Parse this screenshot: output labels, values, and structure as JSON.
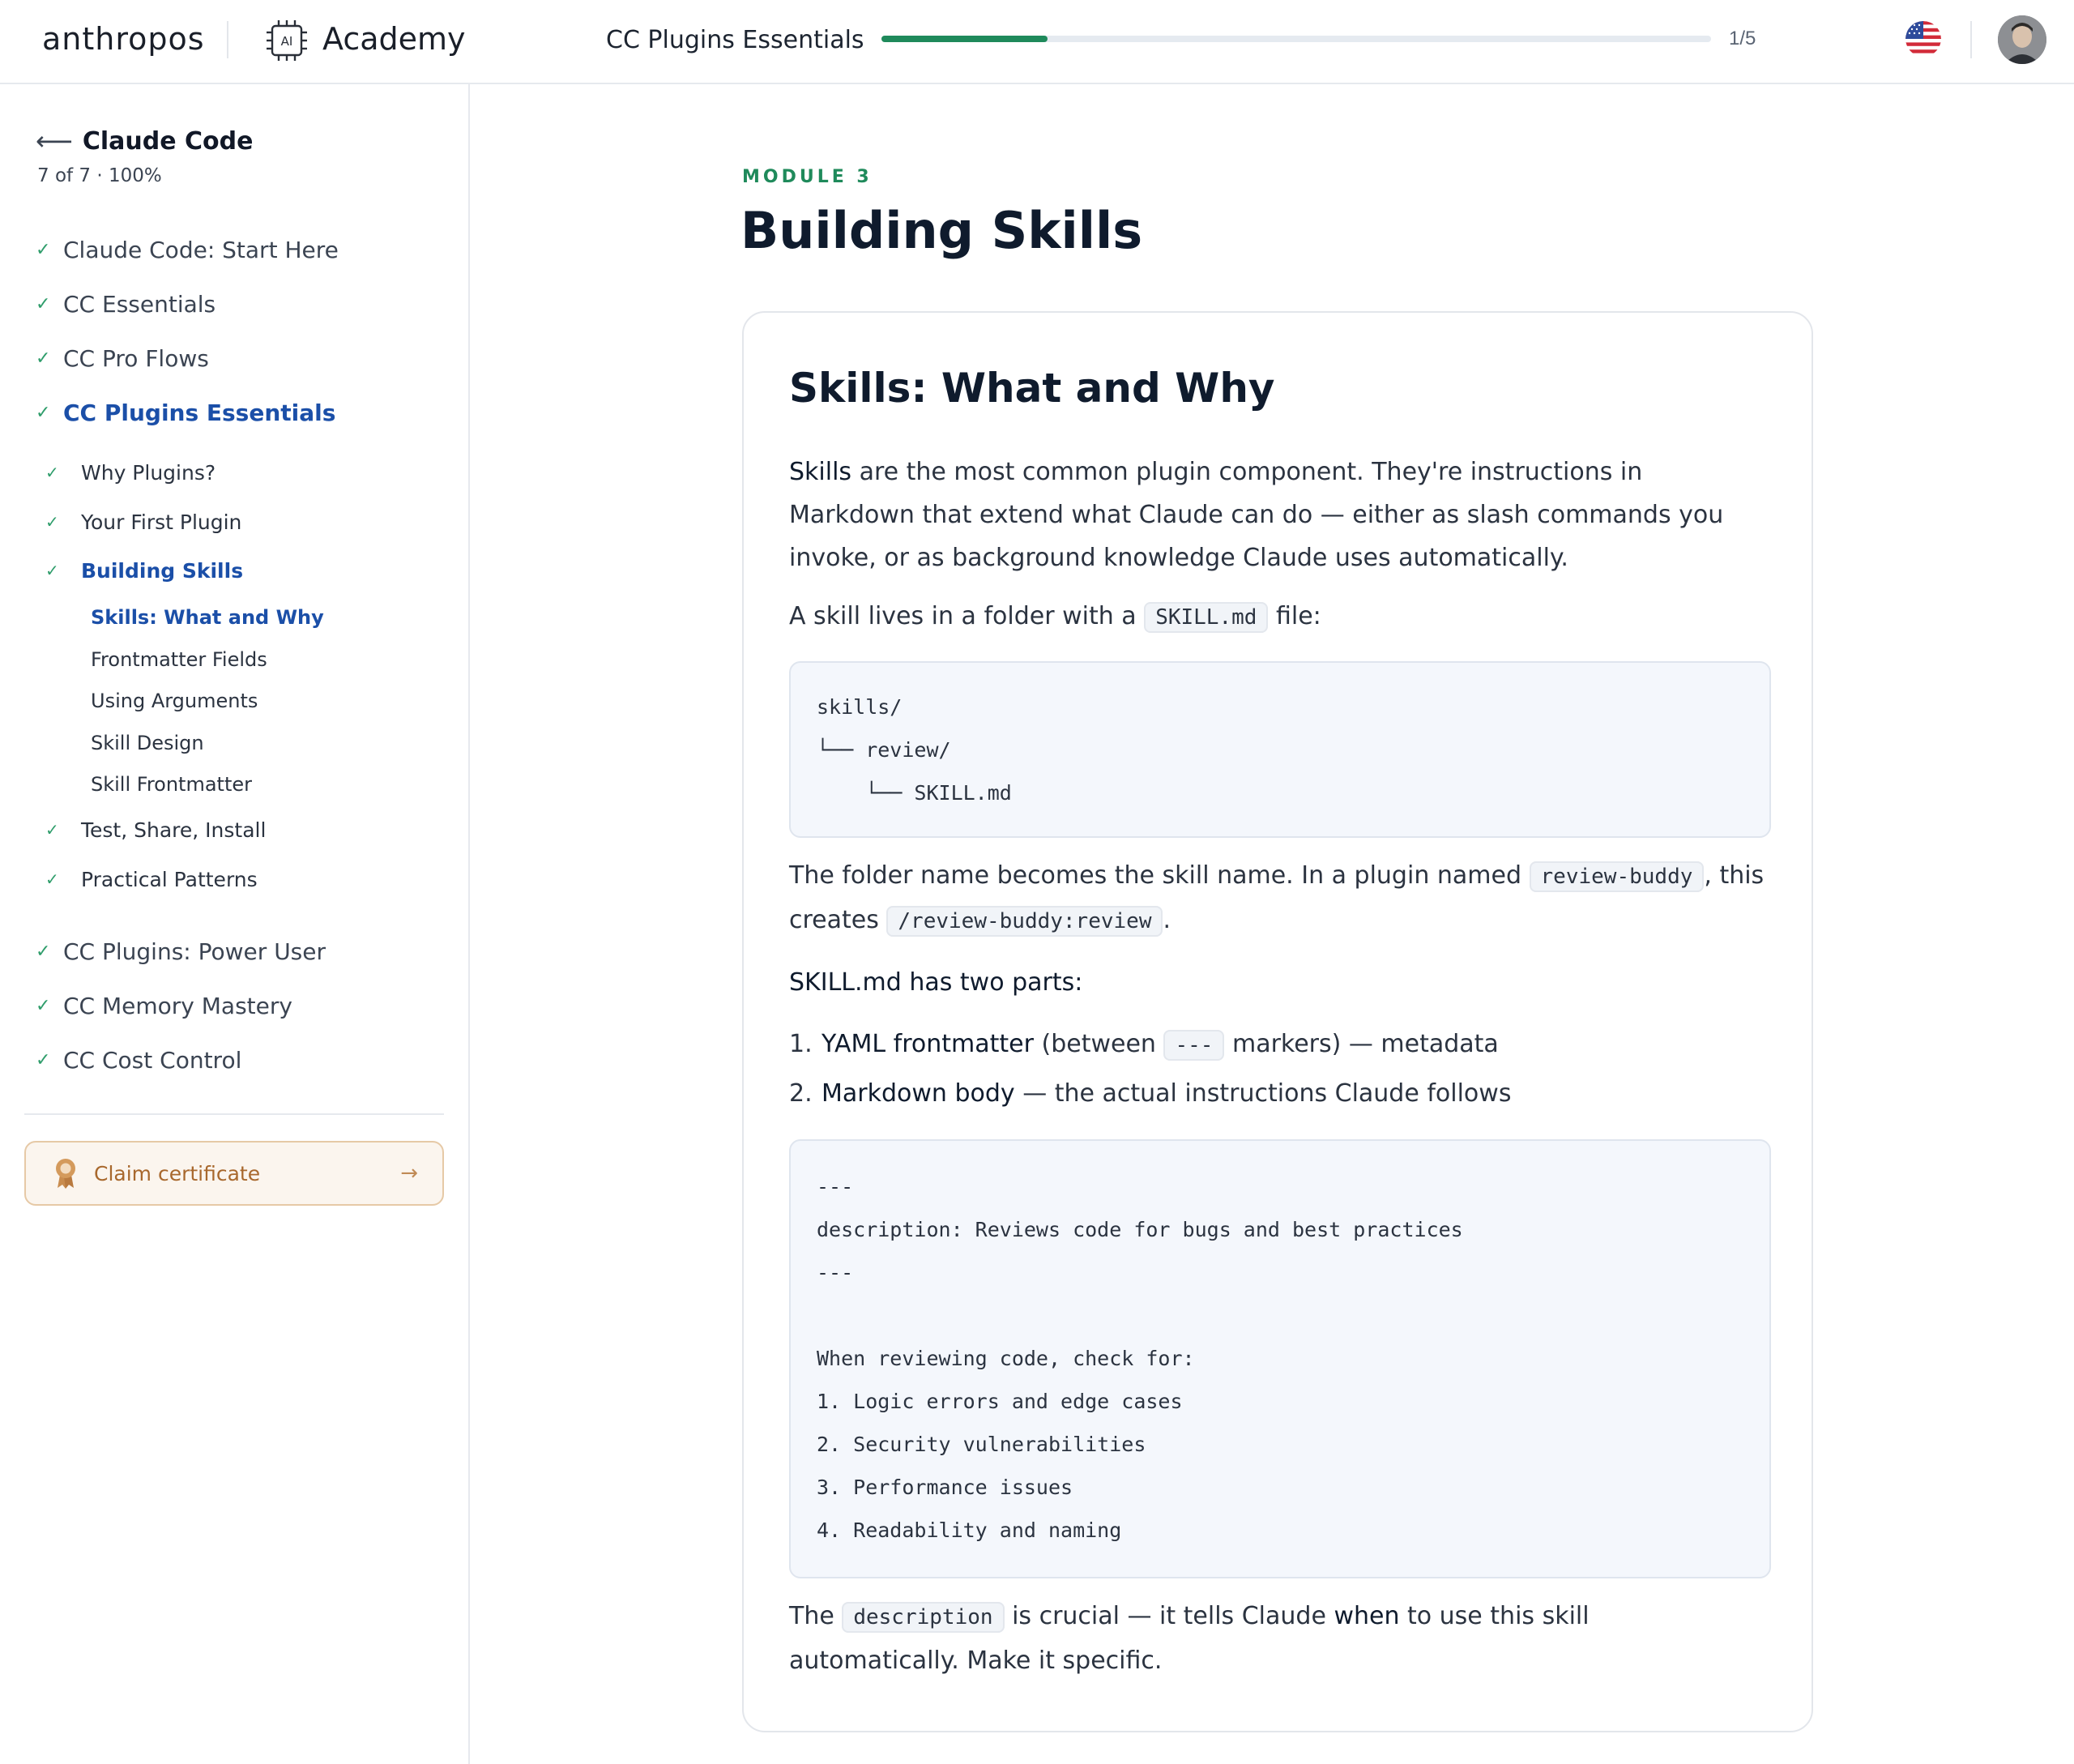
{
  "header": {
    "brand": "anthropos",
    "academy_label": "Academy",
    "academy_icon": "chip-ai-icon",
    "course_title": "CC Plugins Essentials",
    "progress_fraction": 0.2,
    "progress_text": "1/5",
    "progress_color": "#1f8a5b",
    "language_icon": "us-flag-icon",
    "avatar_icon": "user-avatar"
  },
  "sidebar": {
    "back_label": "Claude Code",
    "stats": "7 of 7 · 100%",
    "courses": [
      {
        "label": "Claude Code: Start Here"
      },
      {
        "label": "CC Essentials"
      },
      {
        "label": "CC Pro Flows"
      },
      {
        "label": "CC Plugins Essentials"
      },
      {
        "label": "CC Plugins: Power User"
      },
      {
        "label": "CC Memory Mastery"
      },
      {
        "label": "CC Cost Control"
      }
    ],
    "modules": [
      {
        "label": "Why Plugins?"
      },
      {
        "label": "Your First Plugin"
      },
      {
        "label": "Building Skills"
      },
      {
        "label": "Test, Share, Install"
      },
      {
        "label": "Practical Patterns"
      }
    ],
    "lessons": [
      {
        "label": "Skills: What and Why"
      },
      {
        "label": "Frontmatter Fields"
      },
      {
        "label": "Using Arguments"
      },
      {
        "label": "Skill Design"
      },
      {
        "label": "Skill Frontmatter"
      }
    ],
    "certificate_label": "Claim certificate",
    "accent_color": "#1b4fa8"
  },
  "main": {
    "module_label": "MODULE 3",
    "page_title": "Building Skills",
    "card_title": "Skills: What and Why",
    "p1": {
      "term": "Skills",
      "line1": " are the most common plugin component. They're instructions in",
      "line2": "Markdown that extend what Claude can do — either as slash commands you",
      "line3": "invoke, or as background knowledge Claude uses automatically."
    },
    "p2": {
      "before": "A skill lives in a folder with a ",
      "code": "SKILL.md",
      "after": " file:"
    },
    "tree": [
      "skills/",
      "└── review/",
      "    └── SKILL.md"
    ],
    "p3": {
      "before": "The folder name becomes the skill name. In a plugin named ",
      "code1": "review-buddy",
      "mid": ", this",
      "line2_before": "creates ",
      "code2": "/review-buddy:review",
      "line2_after": "."
    },
    "p4": "SKILL.md has two parts:",
    "list": [
      {
        "num": "1.",
        "term": "YAML frontmatter",
        "before": " (between ",
        "code": "---",
        "after": " markers) — metadata"
      },
      {
        "num": "2.",
        "term": "Markdown body",
        "after": " — the actual instructions Claude follows"
      }
    ],
    "skill_code": [
      "---",
      "description: Reviews code for bugs and best practices",
      "---",
      "",
      "When reviewing code, check for:",
      "1. Logic errors and edge cases",
      "2. Security vulnerabilities",
      "3. Performance issues",
      "4. Readability and naming"
    ],
    "p5": {
      "before": "The ",
      "code": "description",
      "mid": " is crucial — it tells Claude ",
      "term": "when",
      "after": " to use this skill",
      "line2": "automatically. Make it specific."
    }
  }
}
